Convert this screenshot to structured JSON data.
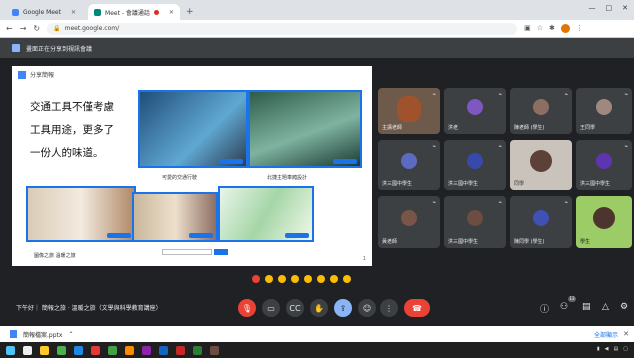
{
  "browser": {
    "tabs": [
      {
        "label": "Google Meet",
        "active": false
      },
      {
        "label": "Meet - 會議通話",
        "active": true
      }
    ],
    "url": "meet.google.com/",
    "window_controls": [
      "—",
      "□",
      "✕"
    ]
  },
  "meet_banner": {
    "text": "畫面正在分享到視訊會議"
  },
  "presentation": {
    "header": "分享簡報",
    "slide_text": [
      "交通工具不僅考慮",
      "工具用途，更多了",
      "一份人的味道。"
    ],
    "captions": [
      "可愛的交通行駛",
      "北捷主題車廂設計",
      "圖像之旅 溫暖之旅"
    ],
    "page_indicator": "1"
  },
  "participants": [
    {
      "name": "主講老師",
      "color": "#a0522d"
    },
    {
      "name": "洪老",
      "color": "#7e57c2"
    },
    {
      "name": "陳老師 (學生)",
      "color": "#8d6e63"
    },
    {
      "name": "王同學",
      "color": "#a1887f"
    },
    {
      "name": "洪三國中學生",
      "color": "#5c6bc0"
    },
    {
      "name": "洪三國中學生",
      "color": "#3949ab"
    },
    {
      "name": "同學",
      "color": "#d7ccc8"
    },
    {
      "name": "洪三國中學生",
      "color": "#5e35b1"
    },
    {
      "name": "黃老師",
      "color": "#795548"
    },
    {
      "name": "洪三國中學生",
      "color": "#6d4c41"
    },
    {
      "name": "陳同學 (學生)",
      "color": "#3f51b5"
    },
    {
      "name": "學生",
      "color": "#8bc34a"
    }
  ],
  "controls": {
    "meeting_title": "下午好｜ 簡報之旅 · 溫暖之旅（文學與科學教育講座）",
    "participant_count": "13",
    "hangup_icon": "phone-hangup-icon"
  },
  "download": {
    "filename": "簡報檔案.pptx",
    "show_all": "全部顯示"
  },
  "colors": {
    "meet_bg": "#202124",
    "tile_bg": "#3c4043",
    "accent": "#1a73e8",
    "hangup": "#ea4335"
  }
}
